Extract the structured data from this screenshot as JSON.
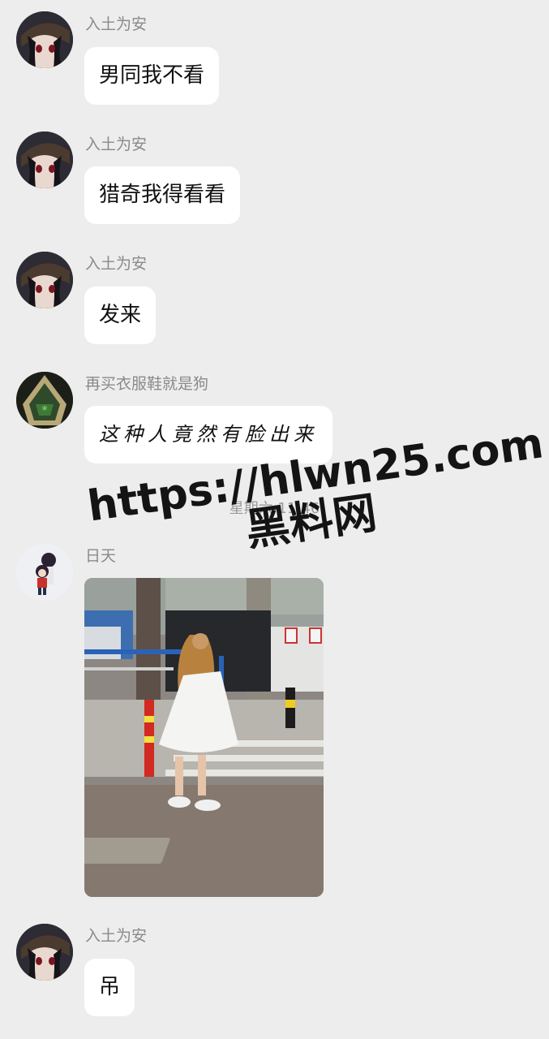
{
  "messages": [
    {
      "sender": "入土为安",
      "text": "男同我不看"
    },
    {
      "sender": "入土为安",
      "text": "猎奇我得看看"
    },
    {
      "sender": "入土为安",
      "text": "发来"
    },
    {
      "sender": "再买衣服鞋就是狗",
      "text": "这种人竟然有脸出来"
    },
    {
      "sender": "日天",
      "image_alt": "photo"
    },
    {
      "sender": "入土为安",
      "text": "吊"
    }
  ],
  "timestamp": "星期六 11:46",
  "watermark": {
    "url": "https://hlwn25.com",
    "name": "黑料网"
  },
  "colors": {
    "background": "#ededed",
    "bubble": "#ffffff",
    "sender": "#8a8a8a"
  },
  "avatars": [
    "anime-girl-avatar",
    "anime-girl-avatar",
    "anime-girl-avatar",
    "green-hood-avatar",
    "chibi-couple-avatar",
    "anime-girl-avatar"
  ]
}
